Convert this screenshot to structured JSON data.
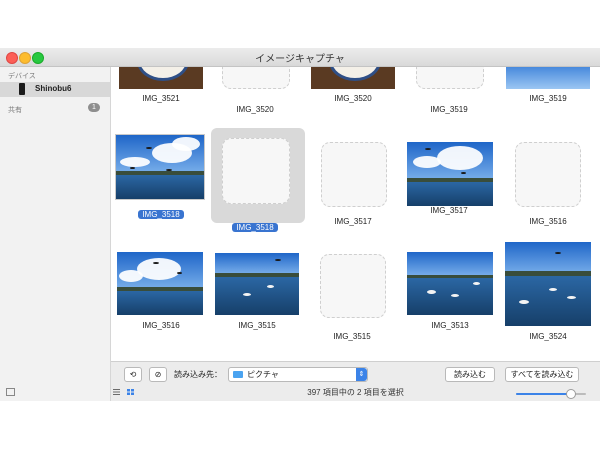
{
  "window": {
    "title": "イメージキャプチャ"
  },
  "sidebar": {
    "devices_label": "デバイス",
    "device_name": "Shinobu6",
    "shared_label": "共有",
    "shared_count": "1"
  },
  "grid": {
    "row1": [
      "IMG_3521",
      "IMG_3520",
      "IMG_3520",
      "IMG_3519",
      "IMG_3519"
    ],
    "row2": [
      "IMG_3518",
      "IMG_3518",
      "IMG_3517",
      "IMG_3517",
      "IMG_3516"
    ],
    "row3": [
      "IMG_3516",
      "IMG_3515",
      "IMG_3515",
      "IMG_3513",
      "IMG_3524"
    ]
  },
  "toolbar": {
    "import_to_label": "読み込み先：",
    "destination": "ピクチャ",
    "import_button": "読み込む",
    "import_all_button": "すべてを読み込む",
    "status": "397 項目中の 2 項目を選択"
  },
  "colors": {
    "selection": "#3974d0",
    "accent": "#3b83e8"
  }
}
